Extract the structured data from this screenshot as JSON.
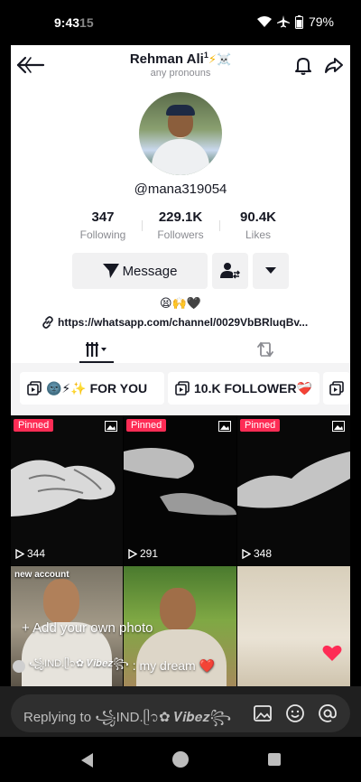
{
  "status_bar": {
    "time": "9:43",
    "time_dim": "15",
    "battery": "79%"
  },
  "header": {
    "title": "Rehman Ali",
    "title_sup": "1",
    "title_deco": "⚡☠️",
    "pronouns": "any pronouns"
  },
  "profile": {
    "username": "@mana319054",
    "stats": [
      {
        "value": "347",
        "label": "Following"
      },
      {
        "value": "229.1K",
        "label": "Followers"
      },
      {
        "value": "90.4K",
        "label": "Likes"
      }
    ],
    "message_label": "Message",
    "bio_emoji": "😫🙌🖤",
    "link": "https://whatsapp.com/channel/0029VbBRluqBv..."
  },
  "playlists": [
    {
      "label": "🌚⚡✨ FOR YOU"
    },
    {
      "label": "10.K FOLLOWER❤️‍🩹"
    }
  ],
  "videos": [
    {
      "pinned": "Pinned",
      "views": "344"
    },
    {
      "pinned": "Pinned",
      "views": "291"
    },
    {
      "pinned": "Pinned",
      "views": "348"
    }
  ],
  "overlays": {
    "new_account": "new account",
    "add_photo": "+ Add your own photo",
    "comment_user": "꧁IND.ᥫ᭡✿ 𝑽𝒊𝒃𝒆𝒛꧂",
    "comment_text": ": my dream ❤️"
  },
  "reply_bar": {
    "text": "Replying to ꧁IND.ᥫ᭡✿ 𝑽𝒊𝒃𝒆𝒛꧂"
  },
  "colors": {
    "pinned": "#fe2c55",
    "bolt": "#f4b400",
    "heart": "#fe2c55"
  }
}
